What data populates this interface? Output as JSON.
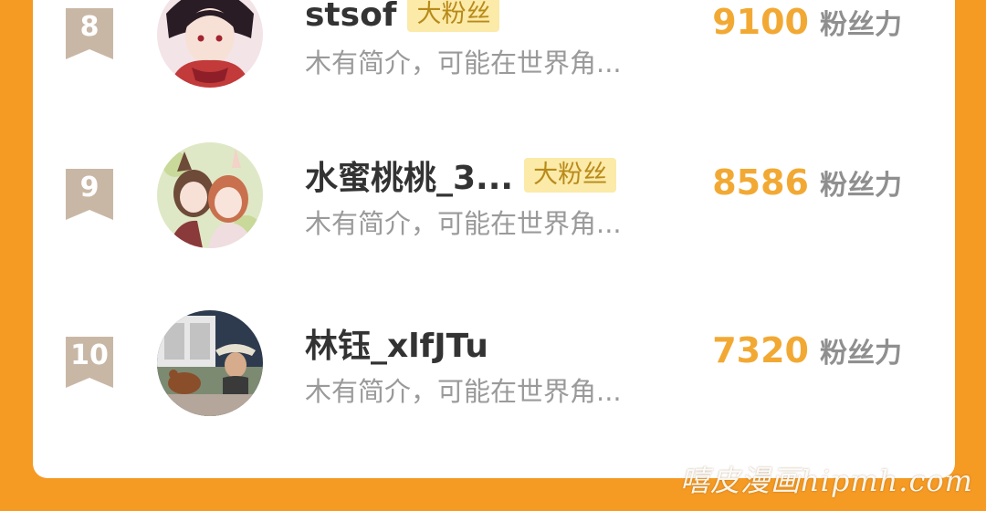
{
  "ranking": {
    "rows": [
      {
        "rank": "8",
        "name": "stsof",
        "badge": "大粉丝",
        "bio": "木有简介，可能在世界角...",
        "score": "9100",
        "unit": "粉丝力"
      },
      {
        "rank": "9",
        "name": "水蜜桃桃_3...",
        "badge": "大粉丝",
        "bio": "木有简介，可能在世界角...",
        "score": "8586",
        "unit": "粉丝力"
      },
      {
        "rank": "10",
        "name": "林钰_xlfJTu",
        "bio": "木有简介，可能在世界角...",
        "score": "7320",
        "unit": "粉丝力"
      }
    ]
  },
  "watermark": "嘻皮漫画hipmh.com",
  "colors": {
    "background": "#f59a23",
    "card": "#ffffff",
    "score": "#f2a934",
    "rank_badge": "#c9b7a6",
    "fan_badge_bg": "#fbeaa8",
    "fan_badge_text": "#b88a1a"
  },
  "icons": {
    "rank": "ribbon-bookmark-icon",
    "avatar_row_8": "anime-avatar",
    "avatar_row_9": "anime-couple-avatar",
    "avatar_row_10": "meme-photo-avatar"
  }
}
